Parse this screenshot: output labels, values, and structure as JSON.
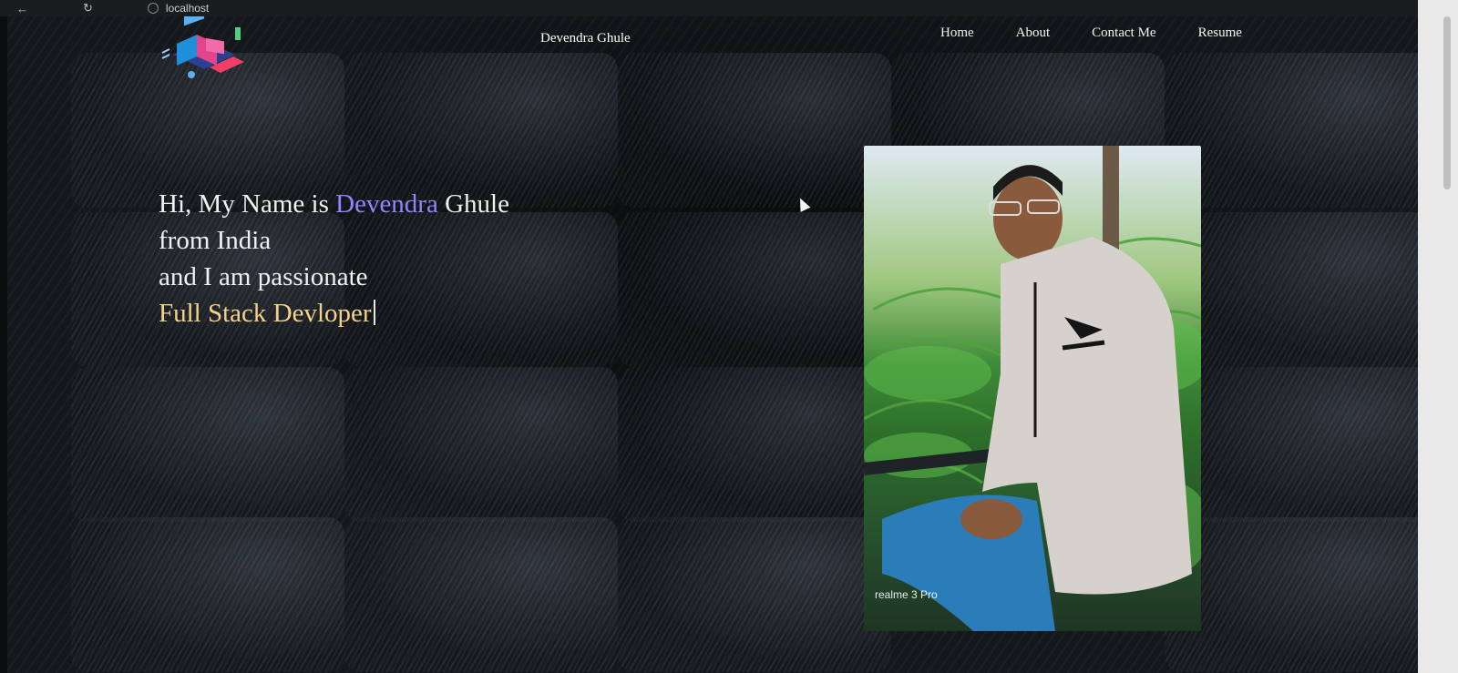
{
  "browser": {
    "address": "localhost"
  },
  "header": {
    "brand": "Devendra Ghule",
    "nav": [
      "Home",
      "About",
      "Contact Me",
      "Resume"
    ]
  },
  "hero": {
    "line1_prefix": "Hi, My Name is ",
    "line1_highlight": "Devendra",
    "line1_suffix": " Ghule",
    "line2": "from India",
    "line3": "and I am passionate",
    "line4": "Full Stack Devloper"
  },
  "photo": {
    "watermark": "realme 3 Pro"
  },
  "colors": {
    "background": "#111315",
    "accent_name": "#8f86ff",
    "accent_role": "#f3d28b",
    "text": "#f1f1f1"
  },
  "icons": [
    "back-arrow-icon",
    "reload-icon",
    "site-info-icon",
    "workspace-logo-icon"
  ]
}
